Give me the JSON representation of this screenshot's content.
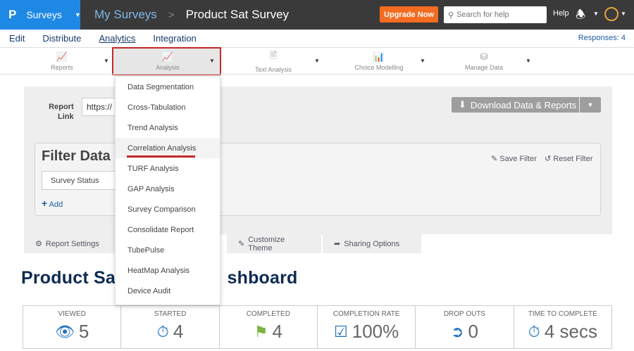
{
  "header": {
    "brand_logo": "P",
    "brand_label": "Surveys",
    "breadcrumb_root": "My Surveys",
    "breadcrumb_sep": ">",
    "survey_title": "Product Sat Survey",
    "upgrade_label": "Upgrade Now",
    "search_placeholder": "Search for help",
    "help_label": "Help"
  },
  "menu": {
    "items": [
      "Edit",
      "Distribute",
      "Analytics",
      "Integration"
    ],
    "active": "Analytics",
    "responses": "Responses: 4"
  },
  "toolbar": {
    "tools": [
      "Reports",
      "Analysis",
      "Text Analysis",
      "Choice Modelling",
      "Manage Data"
    ]
  },
  "report": {
    "link_label_1": "Report",
    "link_label_2": "Link",
    "link_value": "https://",
    "download_label": "Download Data & Reports"
  },
  "filter": {
    "title": "Filter Data",
    "save_label": "Save Filter",
    "reset_label": "Reset Filter",
    "status_value": "Survey Status",
    "add_label": "Add"
  },
  "tabs": [
    "Report Settings",
    "Customize Theme",
    "Sharing Options"
  ],
  "dashboard": {
    "title_left": "Product Sat",
    "title_right": "shboard",
    "stats": [
      {
        "label": "VIEWED",
        "value": "5",
        "icon": "eye-icon",
        "color": "#1e73be"
      },
      {
        "label": "STARTED",
        "value": "4",
        "icon": "stopwatch-icon",
        "color": "#1e73be"
      },
      {
        "label": "COMPLETED",
        "value": "4",
        "icon": "flag-icon",
        "color": "#7cb342"
      },
      {
        "label": "COMPLETION RATE",
        "value": "100%",
        "icon": "checkbox-icon",
        "color": "#1e73be"
      },
      {
        "label": "DROP OUTS",
        "value": "0",
        "icon": "exit-icon",
        "color": "#1e73be"
      },
      {
        "label": "TIME TO COMPLETE",
        "value": "4 secs",
        "icon": "stopwatch-icon",
        "color": "#1e73be"
      }
    ]
  },
  "dropdown": {
    "items": [
      "Data Segmentation",
      "Cross-Tabulation",
      "Trend Analysis",
      "Correlation Analysis",
      "TURF Analysis",
      "GAP Analysis",
      "Survey Comparison",
      "Consolidate Report",
      "TubePulse",
      "HeatMap Analysis",
      "Device Audit"
    ],
    "highlighted": "Correlation Analysis"
  },
  "colors": {
    "header_bg": "#3a3a3a",
    "brand_blue": "#1e88e5",
    "upgrade_orange": "#f36c21",
    "highlight_red": "#c62828",
    "title_navy": "#0d2a52"
  }
}
